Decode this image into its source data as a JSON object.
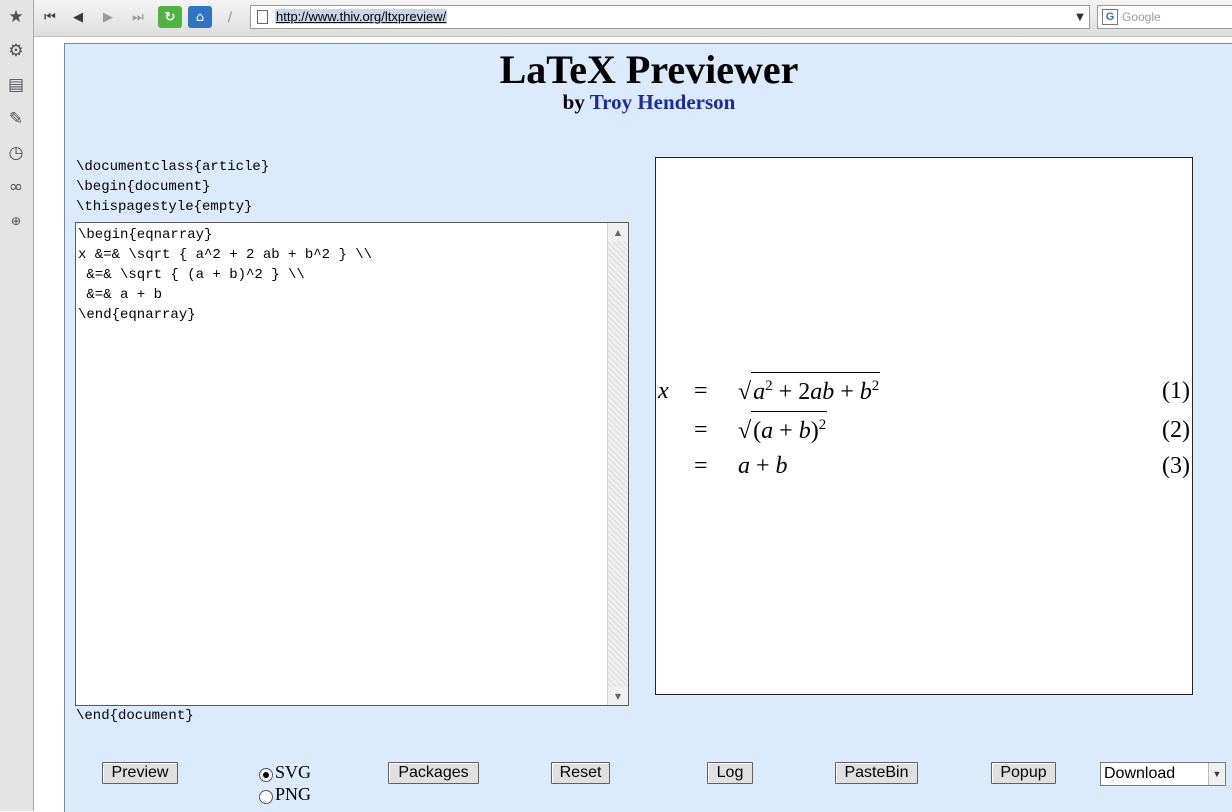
{
  "toolbar": {
    "url": "http://www.thiv.org/ltxpreview/",
    "search_placeholder": "Google",
    "icons": [
      "rewind-icon",
      "back-icon",
      "forward-icon",
      "fast-forward-icon",
      "reload-icon",
      "home-icon",
      "stop-icon"
    ]
  },
  "sidebar": {
    "icons": [
      "bookmark-star-icon",
      "gear-icon",
      "panels-icon",
      "feeds-icon",
      "history-clock-icon",
      "links-icon",
      "add-panel-icon"
    ]
  },
  "page": {
    "title": "LaTeX Previewer",
    "by": "by",
    "author": "Troy Henderson"
  },
  "latex": {
    "preamble": [
      "\\documentclass{article}",
      "\\begin{document}",
      "\\thispagestyle{empty}"
    ],
    "body": "\\begin{eqnarray}\nx &=& \\sqrt { a^2 + 2 ab + b^2 } \\\\\n &=& \\sqrt { (a + b)^2 } \\\\\n &=& a + b\n\\end{eqnarray}",
    "postamble": "\\end{document}"
  },
  "preview": {
    "lhs": "x",
    "equals": "=",
    "eq1_numbers": {
      "coef": "2",
      "exp": "2"
    },
    "numbers": [
      "(1)",
      "(2)",
      "(3)"
    ]
  },
  "controls": {
    "buttons": {
      "preview": "Preview",
      "packages": "Packages",
      "reset": "Reset",
      "log": "Log",
      "pastebin": "PasteBin",
      "popup": "Popup"
    },
    "format_options": [
      "SVG",
      "PNG"
    ],
    "format_selected": "SVG",
    "download": "Download"
  }
}
